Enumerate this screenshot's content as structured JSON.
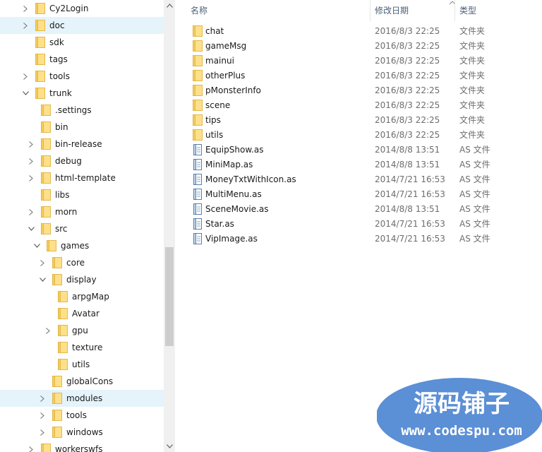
{
  "nav_tree": [
    {
      "label": "Cy2Login",
      "depth": 0,
      "chevron": "right",
      "selected": false
    },
    {
      "label": "doc",
      "depth": 0,
      "chevron": "right",
      "selected": true
    },
    {
      "label": "sdk",
      "depth": 0,
      "chevron": "none",
      "selected": false
    },
    {
      "label": "tags",
      "depth": 0,
      "chevron": "none",
      "selected": false
    },
    {
      "label": "tools",
      "depth": 0,
      "chevron": "right",
      "selected": false
    },
    {
      "label": "trunk",
      "depth": 0,
      "chevron": "down",
      "selected": false
    },
    {
      "label": ".settings",
      "depth": 1,
      "chevron": "none",
      "selected": false
    },
    {
      "label": "bin",
      "depth": 1,
      "chevron": "none",
      "selected": false
    },
    {
      "label": "bin-release",
      "depth": 1,
      "chevron": "right",
      "selected": false
    },
    {
      "label": "debug",
      "depth": 1,
      "chevron": "right",
      "selected": false
    },
    {
      "label": "html-template",
      "depth": 1,
      "chevron": "right",
      "selected": false
    },
    {
      "label": "libs",
      "depth": 1,
      "chevron": "none",
      "selected": false
    },
    {
      "label": "morn",
      "depth": 1,
      "chevron": "right",
      "selected": false
    },
    {
      "label": "src",
      "depth": 1,
      "chevron": "down",
      "selected": false
    },
    {
      "label": "games",
      "depth": 2,
      "chevron": "down",
      "selected": false
    },
    {
      "label": "core",
      "depth": 3,
      "chevron": "right",
      "selected": false
    },
    {
      "label": "display",
      "depth": 3,
      "chevron": "down",
      "selected": false
    },
    {
      "label": "arpgMap",
      "depth": 4,
      "chevron": "none",
      "selected": false
    },
    {
      "label": "Avatar",
      "depth": 4,
      "chevron": "none",
      "selected": false
    },
    {
      "label": "gpu",
      "depth": 4,
      "chevron": "right",
      "selected": false
    },
    {
      "label": "texture",
      "depth": 4,
      "chevron": "none",
      "selected": false
    },
    {
      "label": "utils",
      "depth": 4,
      "chevron": "none",
      "selected": false
    },
    {
      "label": "globalCons",
      "depth": 3,
      "chevron": "none",
      "selected": false
    },
    {
      "label": "modules",
      "depth": 3,
      "chevron": "right",
      "selected": true
    },
    {
      "label": "tools",
      "depth": 3,
      "chevron": "right",
      "selected": false
    },
    {
      "label": "windows",
      "depth": 3,
      "chevron": "right",
      "selected": false
    },
    {
      "label": "workerswfs",
      "depth": 1,
      "chevron": "right",
      "selected": false
    }
  ],
  "columns": {
    "name": "名称",
    "date": "修改日期",
    "type": "类型"
  },
  "files": [
    {
      "name": "chat",
      "date": "2016/8/3 22:25",
      "type": "文件夹",
      "icon": "folder"
    },
    {
      "name": "gameMsg",
      "date": "2016/8/3 22:25",
      "type": "文件夹",
      "icon": "folder"
    },
    {
      "name": "mainui",
      "date": "2016/8/3 22:25",
      "type": "文件夹",
      "icon": "folder"
    },
    {
      "name": "otherPlus",
      "date": "2016/8/3 22:25",
      "type": "文件夹",
      "icon": "folder"
    },
    {
      "name": "pMonsterInfo",
      "date": "2016/8/3 22:25",
      "type": "文件夹",
      "icon": "folder"
    },
    {
      "name": "scene",
      "date": "2016/8/3 22:25",
      "type": "文件夹",
      "icon": "folder"
    },
    {
      "name": "tips",
      "date": "2016/8/3 22:25",
      "type": "文件夹",
      "icon": "folder"
    },
    {
      "name": "utils",
      "date": "2016/8/3 22:25",
      "type": "文件夹",
      "icon": "folder"
    },
    {
      "name": "EquipShow.as",
      "date": "2014/8/8 13:51",
      "type": "AS 文件",
      "icon": "as-file"
    },
    {
      "name": "MiniMap.as",
      "date": "2014/8/8 13:51",
      "type": "AS 文件",
      "icon": "as-file"
    },
    {
      "name": "MoneyTxtWithIcon.as",
      "date": "2014/7/21 16:53",
      "type": "AS 文件",
      "icon": "as-file"
    },
    {
      "name": "MultiMenu.as",
      "date": "2014/7/21 16:53",
      "type": "AS 文件",
      "icon": "as-file"
    },
    {
      "name": "SceneMovie.as",
      "date": "2014/8/8 13:51",
      "type": "AS 文件",
      "icon": "as-file"
    },
    {
      "name": "Star.as",
      "date": "2014/7/21 16:53",
      "type": "AS 文件",
      "icon": "as-file"
    },
    {
      "name": "VipImage.as",
      "date": "2014/7/21 16:53",
      "type": "AS 文件",
      "icon": "as-file"
    }
  ],
  "watermark": {
    "line1": "源码铺子",
    "line2": "www.codespu.com"
  },
  "colors": {
    "selection": "#e5f3fb",
    "folder": "#ffe08a",
    "header_text": "#4c607a",
    "watermark_blue": "#5b8fd6"
  }
}
